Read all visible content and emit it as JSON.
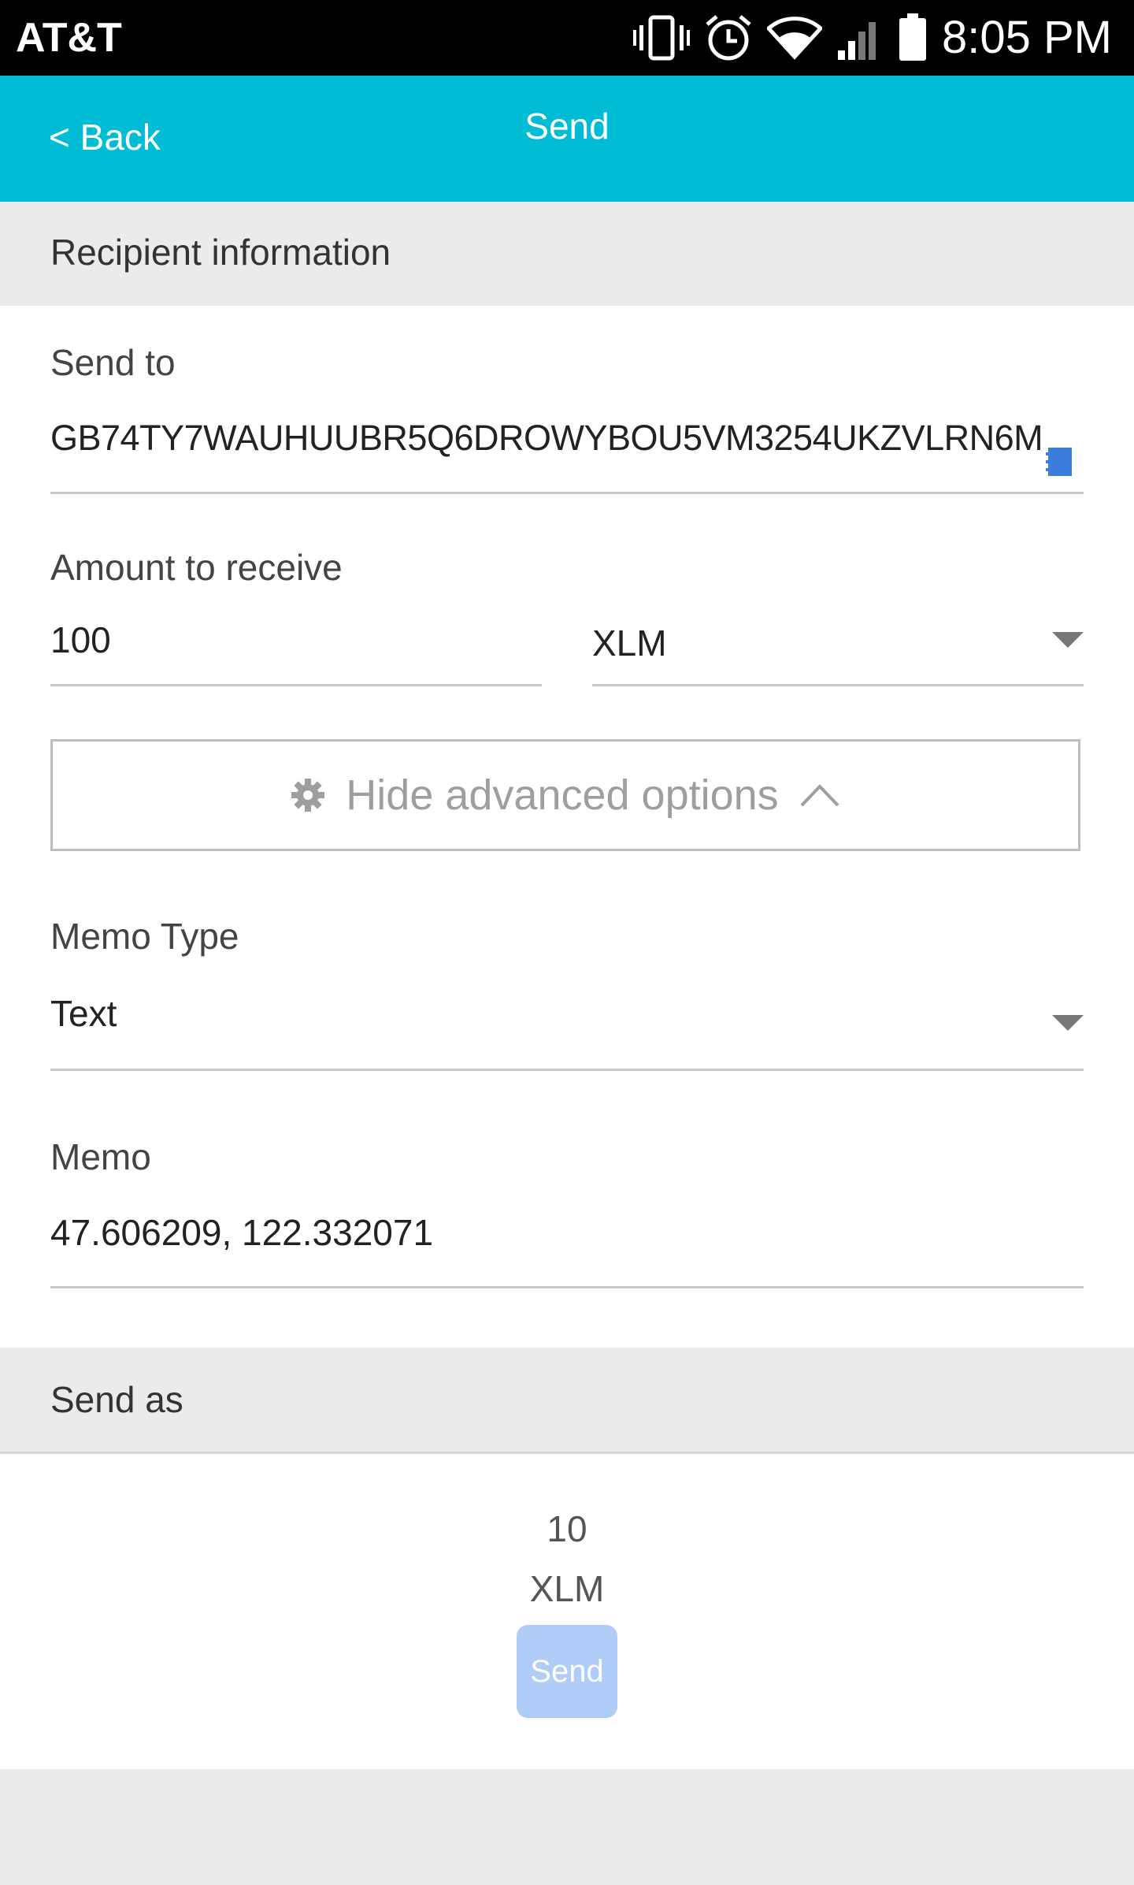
{
  "status_bar": {
    "carrier": "AT&T",
    "time": "8:05 PM",
    "icons": [
      "vibrate-icon",
      "alarm-icon",
      "wifi-icon",
      "signal-icon",
      "battery-icon"
    ]
  },
  "app_bar": {
    "back_label": "< Back",
    "title": "Send"
  },
  "recipient_section": {
    "header": "Recipient information",
    "send_to_label": "Send to",
    "send_to_value": "GB74TY7WAUHUUBR5Q6DROWYBOU5VM3254UKZVLRN6M",
    "amount_label": "Amount to receive",
    "amount_value": "100",
    "asset_value": "XLM",
    "advanced_toggle_label": "Hide advanced options",
    "memo_type_label": "Memo Type",
    "memo_type_value": "Text",
    "memo_label": "Memo",
    "memo_value": "47.606209, 122.332071"
  },
  "send_as_section": {
    "header": "Send as",
    "amount": "10",
    "asset": "XLM",
    "send_button_label": "Send"
  },
  "colors": {
    "app_bar": "#00bcd4",
    "send_button": "#b0cdf8",
    "contact_icon": "#3b7ddd"
  }
}
